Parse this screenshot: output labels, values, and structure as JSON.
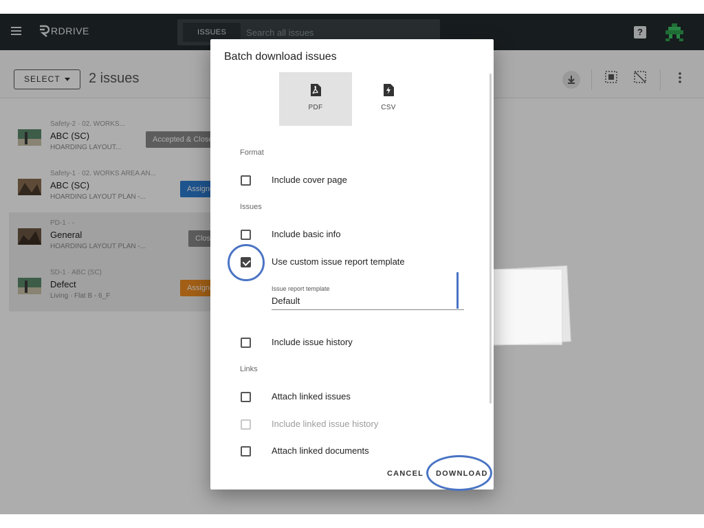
{
  "topbar": {
    "logo_text": "RDRIVE",
    "search_tab": "ISSUES",
    "search_placeholder": "Search all issues",
    "help_label": "?"
  },
  "toolbar": {
    "select_label": "SELECT",
    "issue_count": "2 issues"
  },
  "issues": [
    {
      "meta": "Safety-2 · 02. WORKS...",
      "title": "ABC (SC)",
      "sub": "HOARDING LAYOUT...",
      "status": "Accepted & Closed",
      "status_color": "#8a8a8a"
    },
    {
      "meta": "Safety-1 · 02. WORKS AREA AN...",
      "title": "ABC (SC)",
      "sub": "HOARDING LAYOUT PLAN -...",
      "status": "Assigned",
      "status_color": "#2d7cd1"
    },
    {
      "meta": "PD-1 · -",
      "title": "General",
      "sub": "HOARDING LAYOUT PLAN -...",
      "status": "Closed",
      "status_color": "#8a8a8a"
    },
    {
      "meta": "SD-1 · ABC (SC)",
      "title": "Defect",
      "sub": "Living · Flat B - 6_F",
      "status": "Assigned",
      "status_color": "#ef8c1f"
    }
  ],
  "dialog": {
    "title": "Batch download issues",
    "formats": [
      {
        "label": "PDF",
        "icon": "pdf-file-icon",
        "selected": true
      },
      {
        "label": "CSV",
        "icon": "csv-file-icon",
        "selected": false
      }
    ],
    "format_section": "Format",
    "include_cover_page": "Include cover page",
    "issues_section": "Issues",
    "include_basic_info": "Include basic info",
    "use_custom_template": "Use custom issue report template",
    "template_field_label": "Issue report template",
    "template_field_value": "Default",
    "include_issue_history": "Include issue history",
    "links_section": "Links",
    "attach_linked_issues": "Attach linked issues",
    "include_linked_issue_history": "Include linked issue history",
    "attach_linked_documents": "Attach linked documents",
    "cancel_label": "CANCEL",
    "download_label": "DOWNLOAD"
  },
  "checkbox_states": {
    "include_cover_page": false,
    "include_basic_info": false,
    "use_custom_template": true,
    "include_issue_history": false,
    "attach_linked_issues": false,
    "include_linked_issue_history": false,
    "attach_linked_documents": false
  },
  "colors": {
    "topbar_bg": "#222a2d",
    "annotation": "#4a74c4"
  }
}
